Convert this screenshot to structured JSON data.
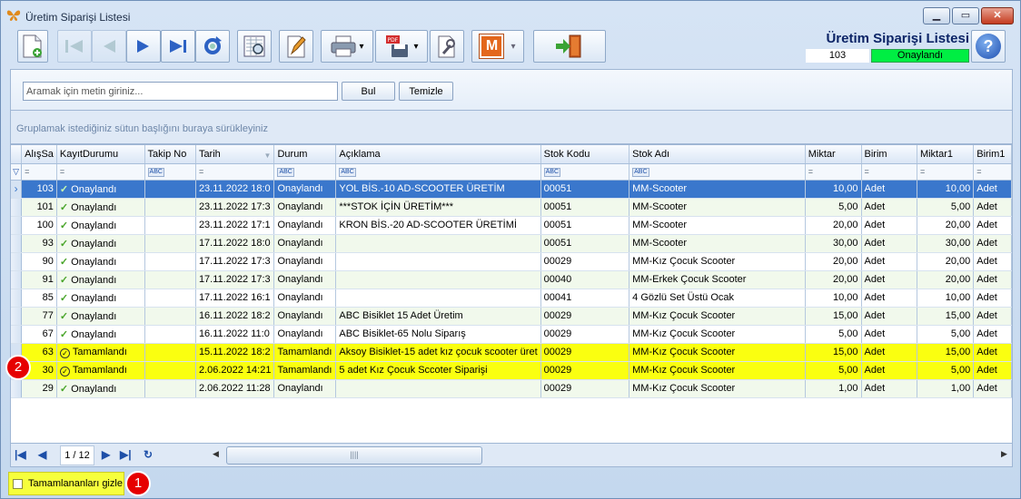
{
  "window": {
    "title": "Üretim Siparişi Listesi",
    "min": "▁",
    "max": "▭",
    "close": "✕"
  },
  "header": {
    "title": "Üretim Siparişi Listesi",
    "number": "103",
    "status": "Onaylandı"
  },
  "toolbar": {
    "icons": [
      "new-doc-icon",
      "first-icon",
      "prev-icon",
      "next-icon",
      "last-icon",
      "refresh-icon",
      "preview-icon",
      "edit-icon",
      "print-icon",
      "pdf-icon",
      "tools-icon",
      "m-icon",
      "exit-icon",
      "help-icon"
    ],
    "m_label": "M",
    "help_label": "?",
    "dropdown": "▾"
  },
  "search": {
    "placeholder": "Aramak için metin giriniz...",
    "find_label": "Bul",
    "clear_label": "Temizle"
  },
  "group_hint": "Gruplamak istediğiniz sütun başlığını buraya sürükleyiniz",
  "columns": [
    "AlışSa",
    "KayıtDurumu",
    "Takip No",
    "Tarih",
    "Durum",
    "Açıklama",
    "Stok Kodu",
    "Stok Adı",
    "Miktar",
    "Birim",
    "Miktar1",
    "Birim1"
  ],
  "filter": {
    "eq": "=",
    "abc": "ABC"
  },
  "rows": [
    {
      "no": "103",
      "kayit": "Onaylandı",
      "takip": "",
      "tarih": "23.11.2022 18:0",
      "durum": "Onaylandı",
      "aciklama": "YOL BİS.-10 AD-SCOOTER ÜRETİM",
      "stok_kodu": "00051",
      "stok_adi": "MM-Scooter",
      "miktar": "10,00",
      "birim": "Adet",
      "miktar1": "10,00",
      "birim1": "Adet",
      "state": "sel"
    },
    {
      "no": "101",
      "kayit": "Onaylandı",
      "takip": "",
      "tarih": "23.11.2022 17:3",
      "durum": "Onaylandı",
      "aciklama": "***STOK İÇİN ÜRETİM***",
      "stok_kodu": "00051",
      "stok_adi": "MM-Scooter",
      "miktar": "5,00",
      "birim": "Adet",
      "miktar1": "5,00",
      "birim1": "Adet",
      "state": ""
    },
    {
      "no": "100",
      "kayit": "Onaylandı",
      "takip": "",
      "tarih": "23.11.2022 17:1",
      "durum": "Onaylandı",
      "aciklama": "KRON BİS.-20 AD-SCOOTER ÜRETİMİ",
      "stok_kodu": "00051",
      "stok_adi": "MM-Scooter",
      "miktar": "20,00",
      "birim": "Adet",
      "miktar1": "20,00",
      "birim1": "Adet",
      "state": ""
    },
    {
      "no": "93",
      "kayit": "Onaylandı",
      "takip": "",
      "tarih": "17.11.2022 18:0",
      "durum": "Onaylandı",
      "aciklama": "",
      "stok_kodu": "00051",
      "stok_adi": "MM-Scooter",
      "miktar": "30,00",
      "birim": "Adet",
      "miktar1": "30,00",
      "birim1": "Adet",
      "state": ""
    },
    {
      "no": "90",
      "kayit": "Onaylandı",
      "takip": "",
      "tarih": "17.11.2022 17:3",
      "durum": "Onaylandı",
      "aciklama": "",
      "stok_kodu": "00029",
      "stok_adi": "MM-Kız Çocuk Scooter",
      "miktar": "20,00",
      "birim": "Adet",
      "miktar1": "20,00",
      "birim1": "Adet",
      "state": ""
    },
    {
      "no": "91",
      "kayit": "Onaylandı",
      "takip": "",
      "tarih": "17.11.2022 17:3",
      "durum": "Onaylandı",
      "aciklama": "",
      "stok_kodu": "00040",
      "stok_adi": "MM-Erkek Çocuk Scooter",
      "miktar": "20,00",
      "birim": "Adet",
      "miktar1": "20,00",
      "birim1": "Adet",
      "state": ""
    },
    {
      "no": "85",
      "kayit": "Onaylandı",
      "takip": "",
      "tarih": "17.11.2022 16:1",
      "durum": "Onaylandı",
      "aciklama": "",
      "stok_kodu": "00041",
      "stok_adi": "4 Gözlü Set Üstü Ocak",
      "miktar": "10,00",
      "birim": "Adet",
      "miktar1": "10,00",
      "birim1": "Adet",
      "state": ""
    },
    {
      "no": "77",
      "kayit": "Onaylandı",
      "takip": "",
      "tarih": "16.11.2022 18:2",
      "durum": "Onaylandı",
      "aciklama": "ABC Bisiklet 15 Adet Üretim",
      "stok_kodu": "00029",
      "stok_adi": "MM-Kız Çocuk Scooter",
      "miktar": "15,00",
      "birim": "Adet",
      "miktar1": "15,00",
      "birim1": "Adet",
      "state": ""
    },
    {
      "no": "67",
      "kayit": "Onaylandı",
      "takip": "",
      "tarih": "16.11.2022 11:0",
      "durum": "Onaylandı",
      "aciklama": "ABC Bisiklet-65 Nolu Siparış",
      "stok_kodu": "00029",
      "stok_adi": "MM-Kız Çocuk Scooter",
      "miktar": "5,00",
      "birim": "Adet",
      "miktar1": "5,00",
      "birim1": "Adet",
      "state": ""
    },
    {
      "no": "63",
      "kayit": "Tamamlandı",
      "takip": "",
      "tarih": "15.11.2022 18:2",
      "durum": "Tamamlandı",
      "aciklama": "Aksoy Bisiklet-15 adet kız çocuk scooter üret",
      "stok_kodu": "00029",
      "stok_adi": "MM-Kız Çocuk Scooter",
      "miktar": "15,00",
      "birim": "Adet",
      "miktar1": "15,00",
      "birim1": "Adet",
      "state": "done"
    },
    {
      "no": "30",
      "kayit": "Tamamlandı",
      "takip": "",
      "tarih": "2.06.2022 14:21",
      "durum": "Tamamlandı",
      "aciklama": "5 adet Kız Çocuk Sccoter Siparişi",
      "stok_kodu": "00029",
      "stok_adi": "MM-Kız Çocuk Scooter",
      "miktar": "5,00",
      "birim": "Adet",
      "miktar1": "5,00",
      "birim1": "Adet",
      "state": "done"
    },
    {
      "no": "29",
      "kayit": "Onaylandı",
      "takip": "",
      "tarih": "2.06.2022 11:28",
      "durum": "Onaylandı",
      "aciklama": "",
      "stok_kodu": "00029",
      "stok_adi": "MM-Kız Çocuk Scooter",
      "miktar": "1,00",
      "birim": "Adet",
      "miktar1": "1,00",
      "birim1": "Adet",
      "state": ""
    }
  ],
  "pager": {
    "page": "1 / 12",
    "first": "|◀",
    "prev": "◀",
    "next": "▶",
    "last": "▶|",
    "refresh": "↻"
  },
  "scroll": {
    "left": "◀",
    "right": "▶",
    "grip": "||||"
  },
  "footer": {
    "hide_completed_label": "Tamamlananları gizle",
    "hide_completed_checked": false
  },
  "badges": {
    "one": "1",
    "two": "2"
  },
  "colors": {
    "selected_row": "#3a77cc",
    "completed_row": "#faff10",
    "status_green": "#00ee43",
    "badge_red": "#e60000"
  }
}
